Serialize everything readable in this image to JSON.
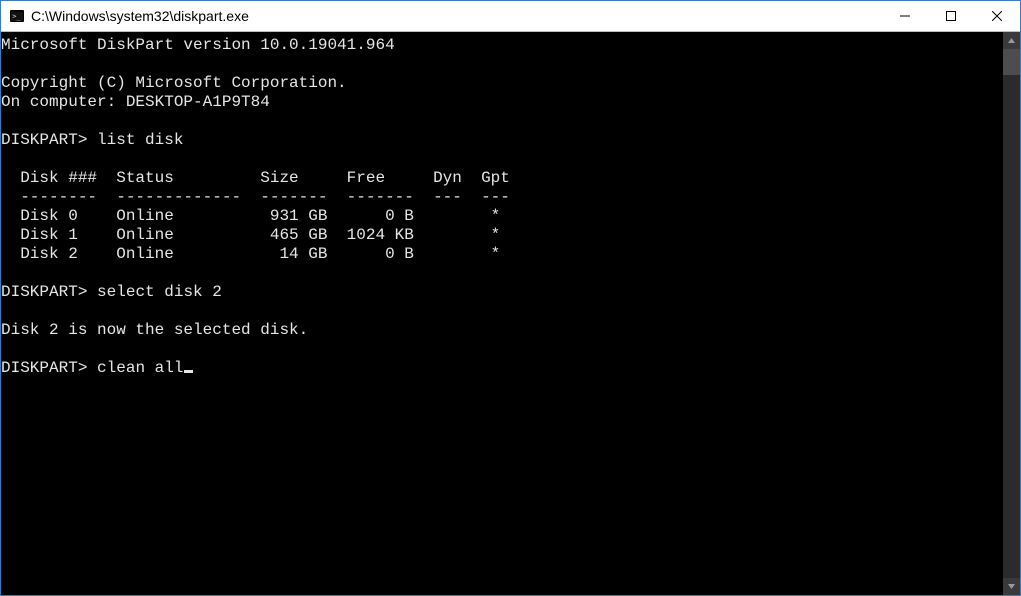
{
  "window": {
    "title": "C:\\Windows\\system32\\diskpart.exe"
  },
  "console": {
    "version_line": "Microsoft DiskPart version 10.0.19041.964",
    "copyright_line": "Copyright (C) Microsoft Corporation.",
    "computer_line": "On computer: DESKTOP-A1P9T84",
    "prompt": "DISKPART>",
    "cmd_list_disk": "list disk",
    "table_header": "  Disk ###  Status         Size     Free     Dyn  Gpt",
    "table_divider": "  --------  -------------  -------  -------  ---  ---",
    "disks": [
      {
        "name": "Disk 0",
        "status": "Online",
        "size": "931 GB",
        "free": "0 B",
        "dyn": "",
        "gpt": "*"
      },
      {
        "name": "Disk 1",
        "status": "Online",
        "size": "465 GB",
        "free": "1024 KB",
        "dyn": "",
        "gpt": "*"
      },
      {
        "name": "Disk 2",
        "status": "Online",
        "size": "14 GB",
        "free": "0 B",
        "dyn": "",
        "gpt": "*"
      }
    ],
    "row0": "  Disk 0    Online          931 GB      0 B        *",
    "row1": "  Disk 1    Online          465 GB  1024 KB        *",
    "row2": "  Disk 2    Online           14 GB      0 B        *",
    "cmd_select_disk": "select disk 2",
    "selected_msg": "Disk 2 is now the selected disk.",
    "cmd_clean_all": "clean all"
  }
}
